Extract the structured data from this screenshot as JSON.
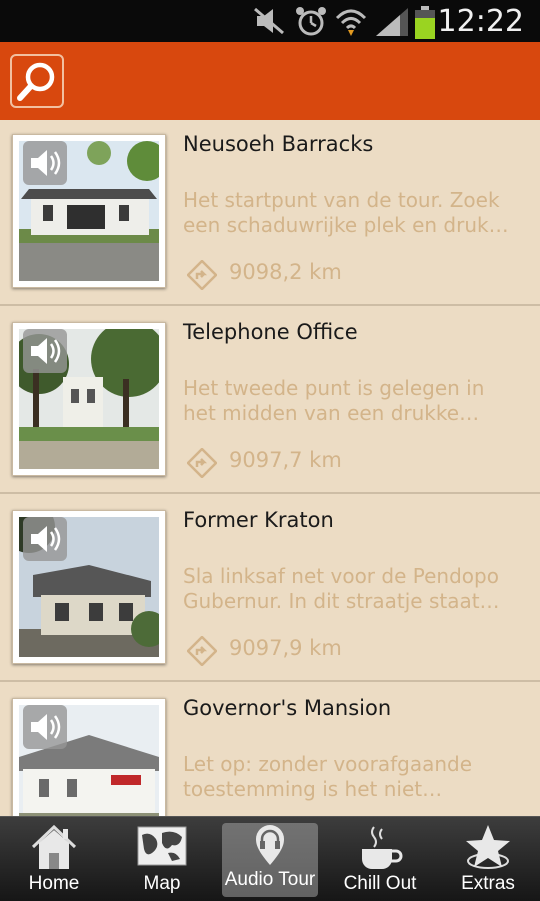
{
  "status_bar": {
    "time": "12:22",
    "icons": [
      "mute-icon",
      "alarm-icon",
      "wifi-icon",
      "signal-icon",
      "battery-icon"
    ]
  },
  "app_bar": {
    "search_icon": "search-icon",
    "color": "#d8480e"
  },
  "list": {
    "items": [
      {
        "title": "Neusoeh Barracks",
        "desc_line1": "Het startpunt van de tour. Zoek",
        "desc_line2": "een schaduwrijke plek en druk…",
        "distance": "9098,2 km"
      },
      {
        "title": "Telephone Office",
        "desc_line1": "Het tweede punt is gelegen in",
        "desc_line2": "het midden van een drukke…",
        "distance": "9097,7 km"
      },
      {
        "title": "Former Kraton",
        "desc_line1": "Sla linksaf net voor de Pendopo",
        "desc_line2": "Gubernur. In dit straatje staat…",
        "distance": "9097,9 km"
      },
      {
        "title": "Governor's Mansion",
        "desc_line1": "Let op: zonder voorafgaande",
        "desc_line2": "toestemming is het niet…",
        "distance": ""
      }
    ]
  },
  "tab_bar": {
    "tabs": [
      {
        "label": "Home",
        "icon": "house-icon"
      },
      {
        "label": "Map",
        "icon": "map-icon"
      },
      {
        "label": "Audio Tour",
        "icon": "headphones-pin-icon",
        "active": true
      },
      {
        "label": "Chill Out",
        "icon": "coffee-cup-icon"
      },
      {
        "label": "Extras",
        "icon": "star-icon"
      }
    ]
  }
}
